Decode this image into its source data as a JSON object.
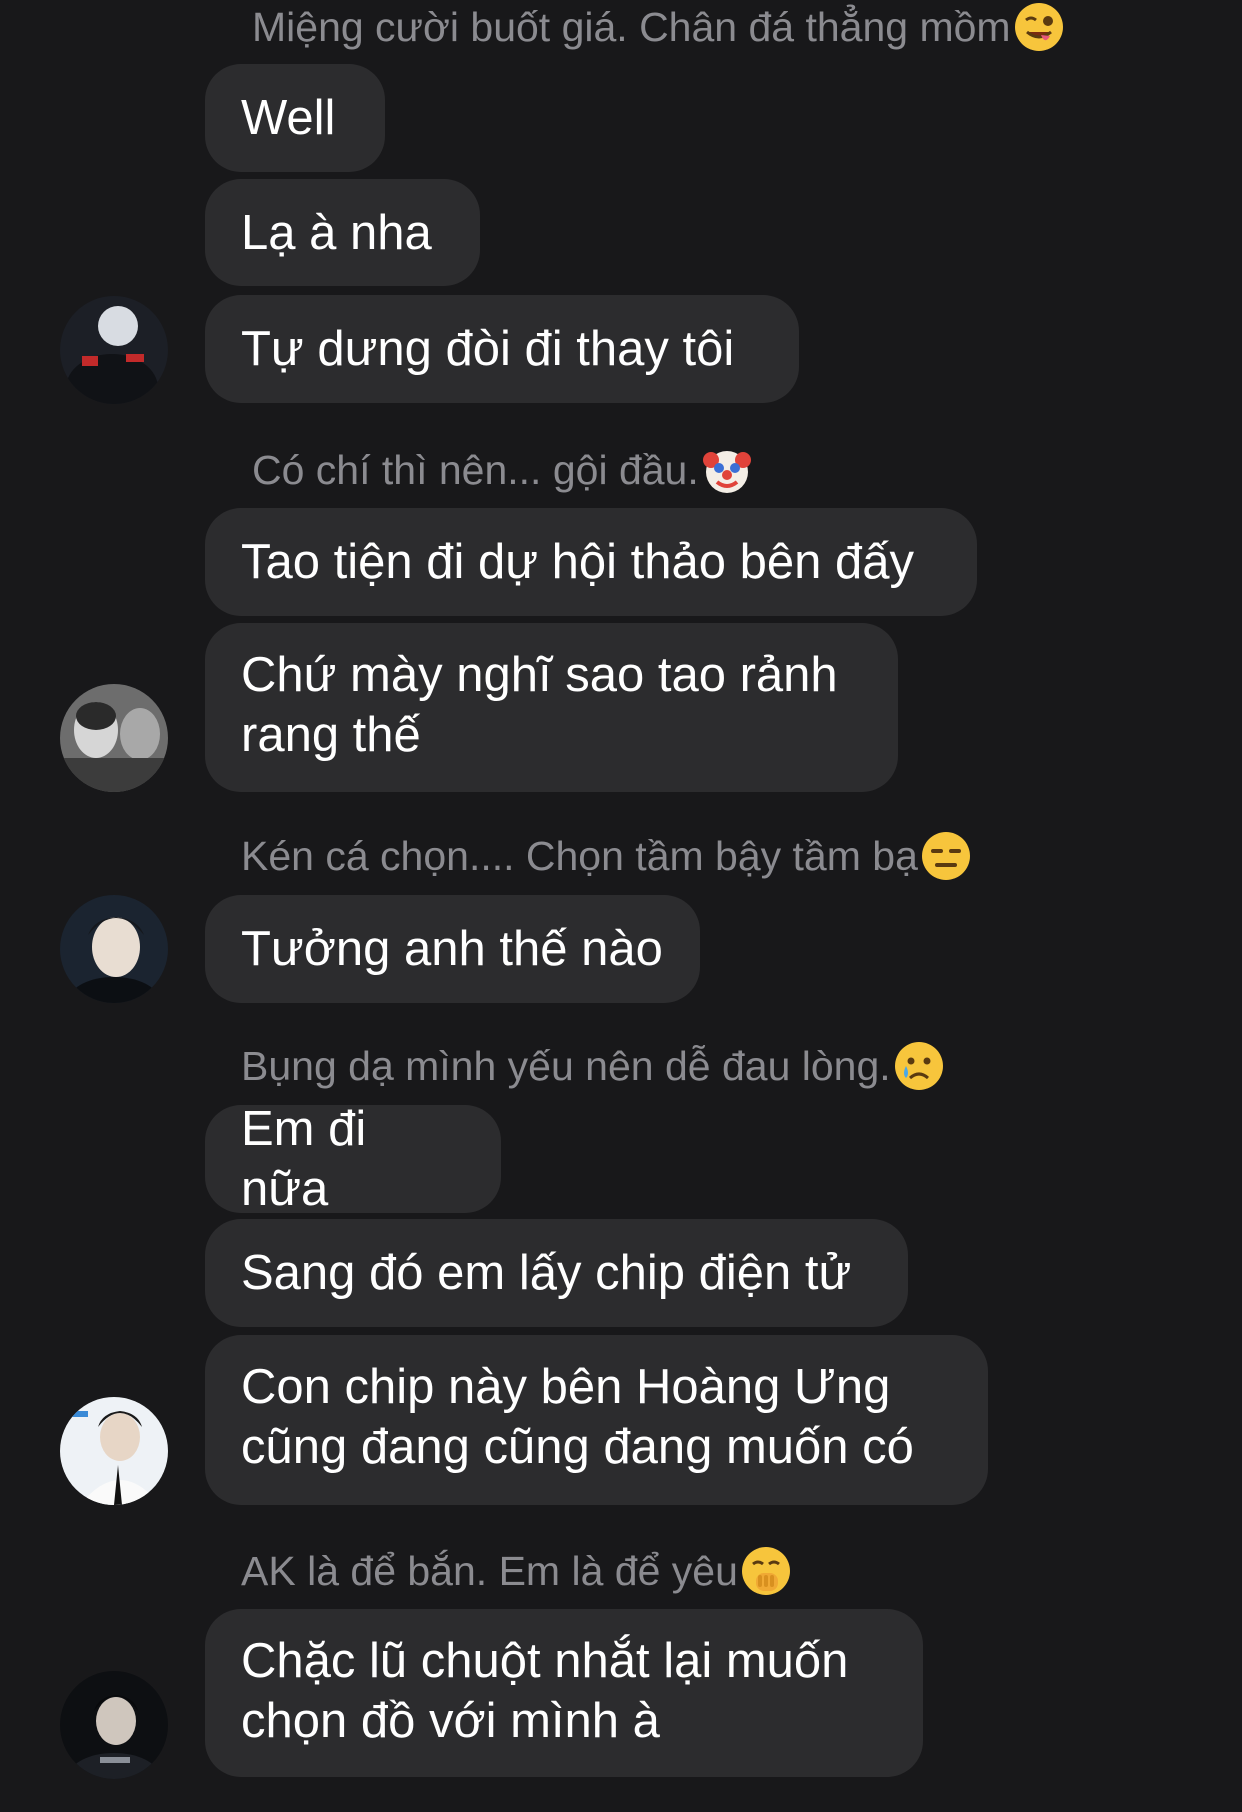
{
  "colors": {
    "background": "#18181a",
    "bubble": "#2c2c2e",
    "caption_text": "#8b8b90",
    "message_text": "#ffffff"
  },
  "captions": [
    {
      "text": "Miệng cười buốt giá. Chân đá thẳng mồm",
      "emoji": "winking-face-tongue-icon"
    },
    {
      "text": "Có chí thì nên... gội đầu.",
      "emoji": "clown-face-icon"
    },
    {
      "text": "Kén cá chọn.... Chọn tầm bậy tầm bạ",
      "emoji": "expressionless-face-icon"
    },
    {
      "text": "Bụng dạ mình yếu nên dễ đau lòng.",
      "emoji": "crying-face-icon"
    },
    {
      "text": "AK là để bắn. Em là để yêu",
      "emoji": "face-with-hand-over-mouth-icon"
    }
  ],
  "messages": [
    {
      "text": "Well"
    },
    {
      "text": "Lạ à nha"
    },
    {
      "text": "Tự dưng đòi đi thay tôi"
    },
    {
      "text": "Tao tiện đi dự hội thảo bên đấy"
    },
    {
      "line1": "Chứ mày nghĩ sao tao rảnh",
      "line2": "rang thế"
    },
    {
      "text": "Tưởng anh thế nào"
    },
    {
      "text": "Em đi nữa"
    },
    {
      "text": "Sang đó em lấy chip điện tử"
    },
    {
      "line1": "Con chip này bên Hoàng Ưng",
      "line2": "cũng đang cũng đang muốn có"
    },
    {
      "line1": "Chặc lũ chuột nhắt lại muốn",
      "line2": "chọn đồ với mình à"
    }
  ],
  "avatars": [
    "avatar-1",
    "avatar-2",
    "avatar-3",
    "avatar-4",
    "avatar-5"
  ]
}
